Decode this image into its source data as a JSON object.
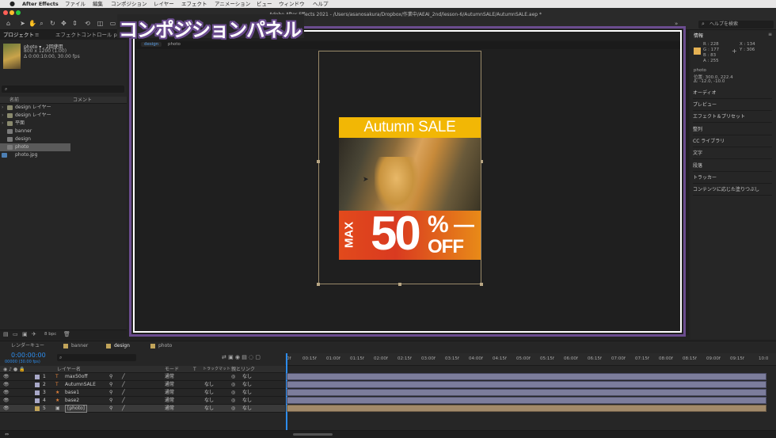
{
  "menubar": {
    "apple": "",
    "app_name": "After Effects",
    "items": [
      "ファイル",
      "編集",
      "コンポジション",
      "レイヤー",
      "エフェクト",
      "アニメーション",
      "ビュー",
      "ウィンドウ",
      "ヘルプ"
    ]
  },
  "window": {
    "title": "Adobe After Effects 2021 - /Users/asanosakura/Dropbox/作業中/AEAI_2nd/lesson-6/AutumnSALE/AutumnSALE.aep *",
    "help_search": "ヘルプを検索"
  },
  "project_panel": {
    "tab": "プロジェクト",
    "effect_tab": "エフェクトコントロール p",
    "selected_name": "photo ▾ , 2回使用",
    "selected_size": "800 x 1200 (1.00)",
    "selected_duration": "Δ 0:00:10:00, 30.00 fps",
    "col_name": "名前",
    "col_comment": "コメント",
    "items": [
      {
        "label": "design レイヤー",
        "arrow": "›"
      },
      {
        "label": "design レイヤー",
        "arrow": "›"
      },
      {
        "label": "平面",
        "arrow": "›"
      },
      {
        "label": "banner",
        "arrow": ""
      },
      {
        "label": "design",
        "arrow": ""
      },
      {
        "label": "photo",
        "arrow": ""
      },
      {
        "label": "photo.jpg",
        "arrow": ""
      }
    ],
    "bpc": "8 bpc"
  },
  "comp_panel": {
    "tabs": [
      "design",
      "photo"
    ],
    "banner": {
      "title": "Autumn SALE",
      "max": "MAX",
      "fifty": "50",
      "pct": "%",
      "dash": "—",
      "off": "OFF"
    }
  },
  "overlay": {
    "label": "コンポジションパネル"
  },
  "info_panel": {
    "tab": "情報",
    "r": "R : 228",
    "g": "G : 177",
    "b": "B : 83",
    "a": "A : 255",
    "x": "X : 134",
    "y": "Y : 306",
    "layer": "photo",
    "pos": "位置: 300.0, 222.4",
    "delta": "Δ: -12.0, -10.0"
  },
  "side_panels": [
    "オーディオ",
    "プレビュー",
    "エフェクト＆プリセット",
    "整列",
    "CC ライブラリ",
    "文字",
    "段落",
    "トラッカー",
    "コンテンツに応じた塗りつぶし"
  ],
  "timeline": {
    "tabs": [
      "レンダーキュー",
      "banner",
      "design",
      "photo"
    ],
    "timecode": "0:00:00:00",
    "timecode_sub": "00000 (30.00 fps)",
    "col_layer": "レイヤー名",
    "col_mode": "モード",
    "col_t": "T",
    "col_trkmat": "トラックマット",
    "col_parent": "親とリンク",
    "ruler": [
      "0f",
      "00:15f",
      "01:00f",
      "01:15f",
      "02:00f",
      "02:15f",
      "03:00f",
      "03:15f",
      "04:00f",
      "04:15f",
      "05:00f",
      "05:15f",
      "06:00f",
      "06:15f",
      "07:00f",
      "07:15f",
      "08:00f",
      "08:15f",
      "09:00f",
      "09:15f",
      "10:0"
    ],
    "layers": [
      {
        "num": "1",
        "name": "max50off",
        "mode": "通常",
        "trk": "",
        "parent": "なし"
      },
      {
        "num": "2",
        "name": "AutumnSALE",
        "mode": "通常",
        "trk": "なし",
        "parent": "なし"
      },
      {
        "num": "3",
        "name": "base1",
        "mode": "通常",
        "trk": "なし",
        "parent": "なし"
      },
      {
        "num": "4",
        "name": "base2",
        "mode": "通常",
        "trk": "なし",
        "parent": "なし"
      },
      {
        "num": "5",
        "name": "[photo]",
        "mode": "通常",
        "trk": "なし",
        "parent": "なし"
      }
    ]
  },
  "colors": {
    "overlay_border": "#6b4c8f",
    "banner_yellow": "#f2b705",
    "banner_red": "#d9301e",
    "layer_bar": "#7c7d9c",
    "photo_bar": "#a28a6a",
    "accent_blue": "#2d8ceb"
  }
}
